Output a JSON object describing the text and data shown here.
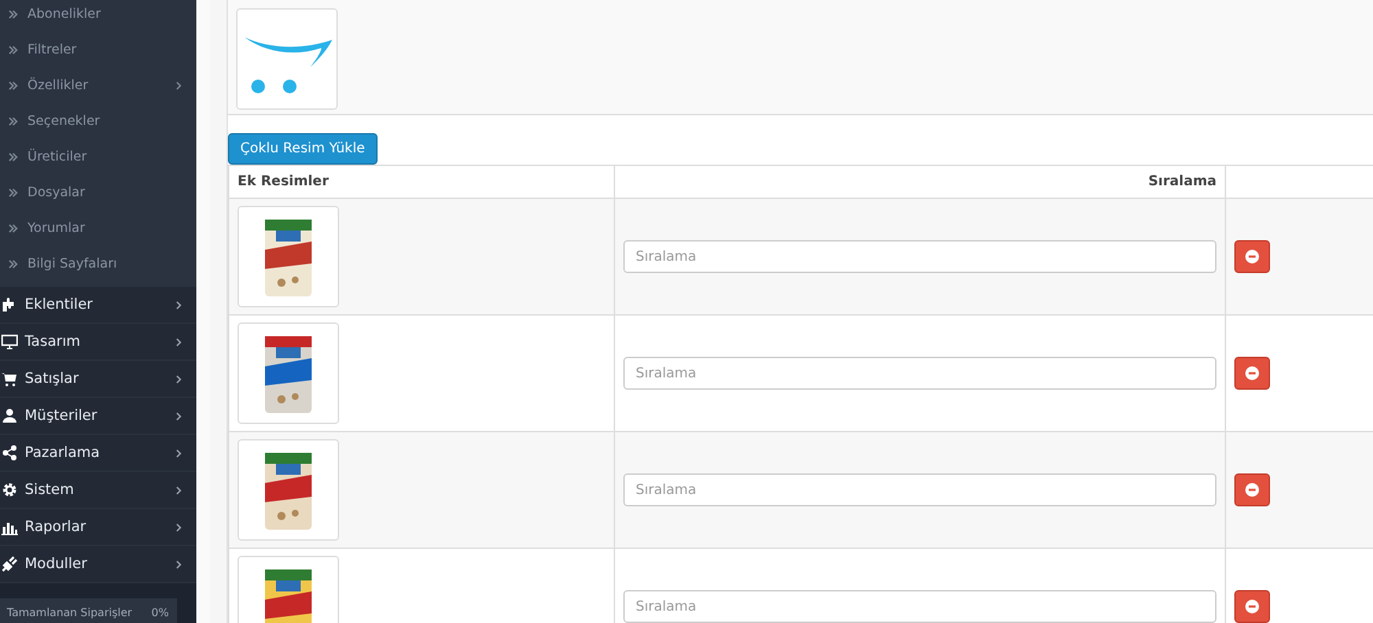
{
  "sidebar": {
    "sub_items": [
      {
        "label": "Abonelikler",
        "has_submenu": false
      },
      {
        "label": "Filtreler",
        "has_submenu": false
      },
      {
        "label": "Özellikler",
        "has_submenu": true
      },
      {
        "label": "Seçenekler",
        "has_submenu": false
      },
      {
        "label": "Üreticiler",
        "has_submenu": false
      },
      {
        "label": "Dosyalar",
        "has_submenu": false
      },
      {
        "label": "Yorumlar",
        "has_submenu": false
      },
      {
        "label": "Bilgi Sayfaları",
        "has_submenu": false
      }
    ],
    "items": [
      {
        "label": "Eklentiler"
      },
      {
        "label": "Tasarım"
      },
      {
        "label": "Satışlar"
      },
      {
        "label": "Müşteriler"
      },
      {
        "label": "Pazarlama"
      },
      {
        "label": "Sistem"
      },
      {
        "label": "Raporlar"
      },
      {
        "label": "Moduller"
      }
    ],
    "progress": {
      "label": "Tamamlanan Siparişler",
      "reading": "0%"
    }
  },
  "upload_button": "Çoklu Resim Yükle",
  "table": {
    "columns": [
      "Ek Resimler",
      "Sıralama"
    ],
    "rows": [
      {
        "sort_placeholder": "Sıralama"
      },
      {
        "sort_placeholder": "Sıralama"
      },
      {
        "sort_placeholder": "Sıralama"
      },
      {
        "sort_placeholder": "Sıralama"
      }
    ]
  }
}
